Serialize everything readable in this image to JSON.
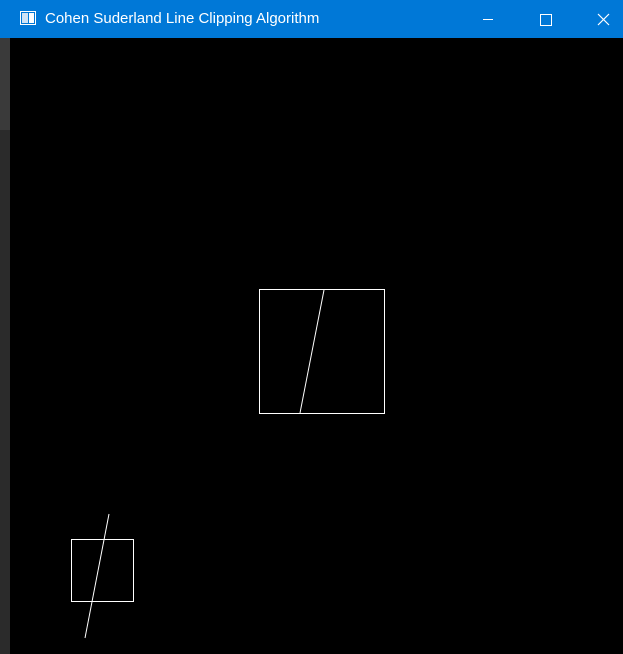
{
  "window": {
    "title": "Cohen Suderland Line Clipping Algorithm",
    "title_bar_color": "#0078d7",
    "canvas_color": "#000000",
    "drawing_color": "#ffffff"
  },
  "controls": {
    "minimize_icon": "minimize-icon",
    "maximize_icon": "maximize-icon",
    "close_icon": "close-icon"
  },
  "app_icon": "window-app-icon"
}
